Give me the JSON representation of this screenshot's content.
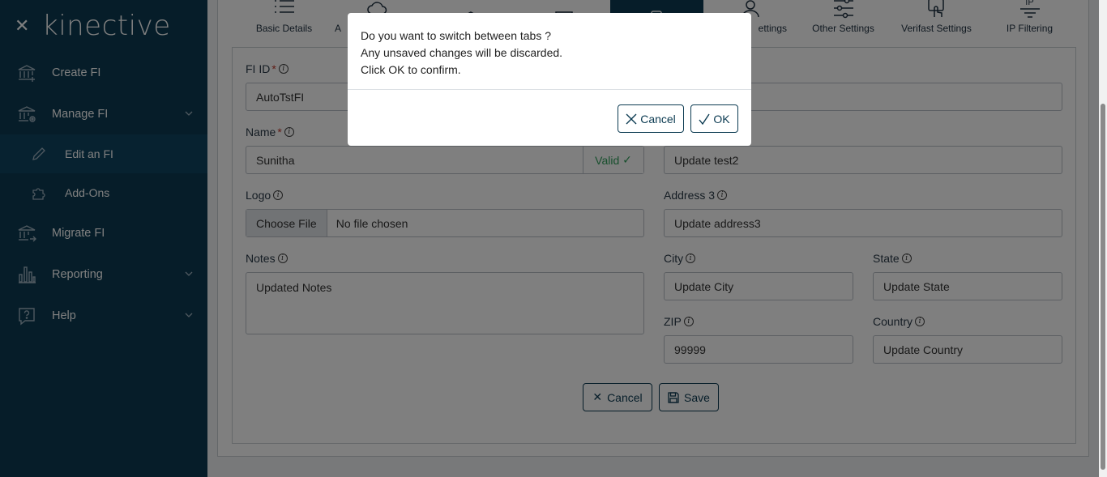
{
  "sidebar": {
    "brand": "kinective",
    "close_icon": "close-icon",
    "items": [
      {
        "label": "Create FI",
        "icon": "bank-plus-icon"
      },
      {
        "label": "Manage FI",
        "icon": "bank-gear-icon"
      },
      {
        "label": "Edit an FI",
        "icon": "pencil-icon"
      },
      {
        "label": "Add-Ons",
        "icon": "puzzle-icon"
      },
      {
        "label": "Migrate FI",
        "icon": "bank-arrow-icon"
      },
      {
        "label": "Reporting",
        "icon": "bar-chart-icon"
      },
      {
        "label": "Help",
        "icon": "help-icon"
      }
    ]
  },
  "tabs": [
    {
      "label": "Basic Details"
    },
    {
      "label": "A"
    },
    {
      "label": ""
    },
    {
      "label": ""
    },
    {
      "label": ""
    },
    {
      "label": "ettings"
    },
    {
      "label": "Other Settings"
    },
    {
      "label": "Verifast Settings"
    },
    {
      "label": "IP Filtering"
    }
  ],
  "tab_ip_text": "IP",
  "form": {
    "fi_id": {
      "label": "FI ID",
      "value": "AutoTstFI"
    },
    "name": {
      "label": "Name",
      "value": "Sunitha",
      "valid": "Valid"
    },
    "logo": {
      "label": "Logo",
      "button": "Choose File",
      "status": "No file chosen"
    },
    "notes": {
      "label": "Notes",
      "value": "Updated Notes"
    },
    "address2": {
      "value": "Update test2"
    },
    "address3": {
      "label": "Address 3",
      "value": "Update address3"
    },
    "city": {
      "label": "City",
      "value": "Update City"
    },
    "state": {
      "label": "State",
      "value": "Update State"
    },
    "zip": {
      "label": "ZIP",
      "value": "99999"
    },
    "country": {
      "label": "Country",
      "value": "Update Country"
    },
    "required_mark": "*",
    "info_glyph": "i",
    "cancel": "Cancel",
    "save": "Save"
  },
  "dialog": {
    "line1": "Do you want to switch between tabs ?",
    "line2": "Any unsaved changes will be discarded.",
    "line3": "Click OK to confirm.",
    "cancel": "Cancel",
    "ok": "OK"
  },
  "colors": {
    "sidebar": "#0c3b52",
    "accent": "#0c3b52",
    "valid": "#2f9e5a",
    "required": "#c0392b"
  }
}
